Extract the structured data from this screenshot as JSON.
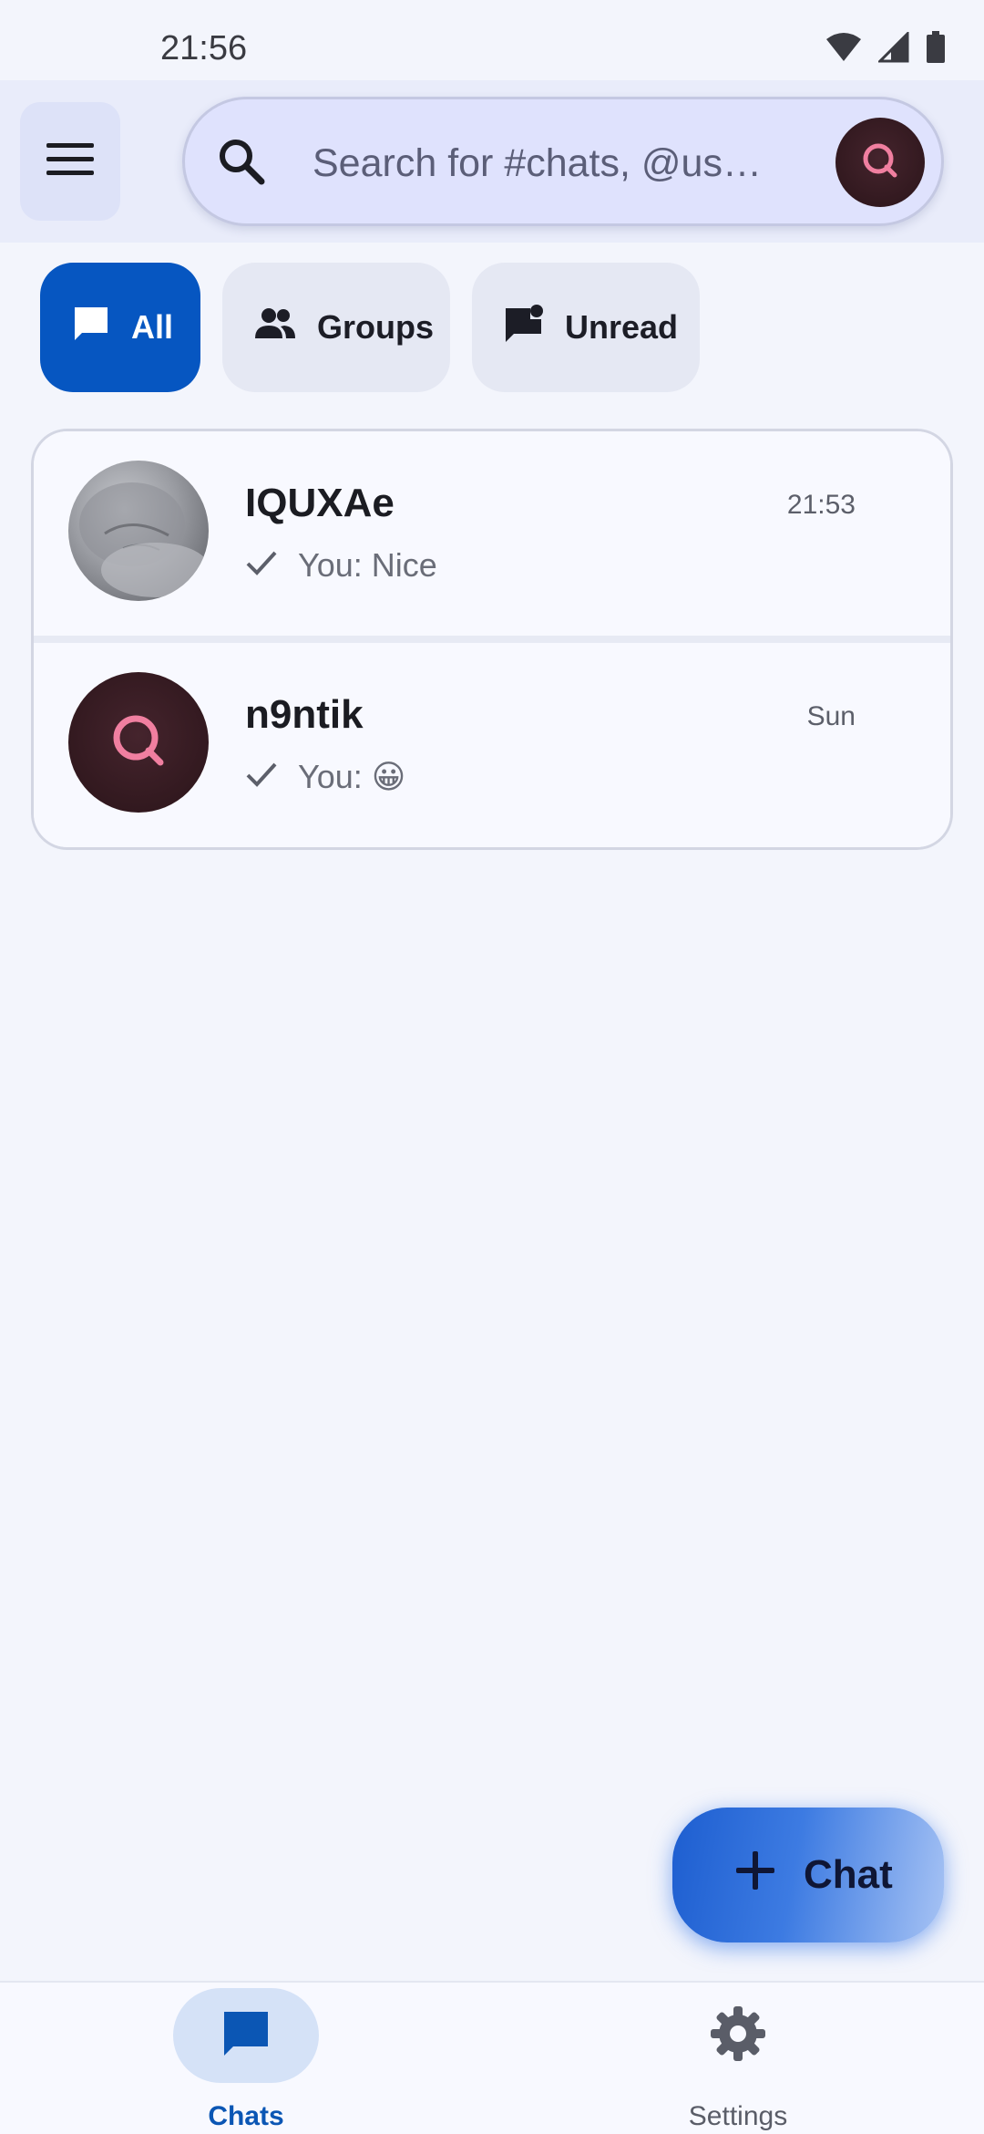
{
  "status_bar": {
    "time": "21:56",
    "icons": [
      "wifi-icon",
      "signal-icon",
      "battery-icon"
    ]
  },
  "header": {
    "menu_icon": "hamburger-menu-icon",
    "search": {
      "placeholder": "Search for #chats, @us…",
      "icon": "search-icon",
      "avatar_icon": "q-logo-icon"
    }
  },
  "filters": [
    {
      "label": "All",
      "icon": "chat-bubble-icon",
      "active": true
    },
    {
      "label": "Groups",
      "icon": "groups-icon",
      "active": false
    },
    {
      "label": "Unread",
      "icon": "unread-chat-icon",
      "active": false
    }
  ],
  "chats": [
    {
      "name": "IQUXAe",
      "time": "21:53",
      "preview": "You: Nice",
      "status_icon": "check-icon",
      "avatar": "cat-photo"
    },
    {
      "name": "n9ntik",
      "time": "Sun",
      "preview": "You: 😀",
      "status_icon": "check-icon",
      "avatar": "q-logo-icon"
    }
  ],
  "fab": {
    "label": "Chat",
    "icon": "plus-icon"
  },
  "bottom_nav": [
    {
      "label": "Chats",
      "icon": "chat-bubble-icon",
      "active": true
    },
    {
      "label": "Settings",
      "icon": "gear-icon",
      "active": false
    }
  ],
  "colors": {
    "accent": "#0656c1",
    "background": "#f3f5fc",
    "search_bar": "#dfe2fd",
    "q_logo_pink": "#f07fa0"
  }
}
